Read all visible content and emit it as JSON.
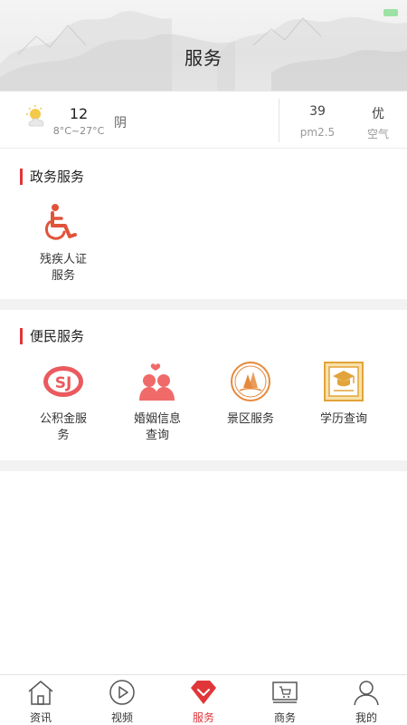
{
  "header": {
    "title": "服务"
  },
  "weather": {
    "temperature": "12",
    "range": "8°C~27°C",
    "condition": "阴",
    "pm_value": "39",
    "pm_label": "pm2.5",
    "aq_value": "优",
    "aq_label": "空气",
    "icon": "cloudy-sun-icon"
  },
  "gov_services": {
    "title": "政务服务",
    "items": [
      {
        "label_line1": "残疾人证",
        "label_line2": "服务",
        "icon": "wheelchair-icon"
      }
    ]
  },
  "public_services": {
    "title": "便民服务",
    "items": [
      {
        "label_line1": "公积金服",
        "label_line2": "务",
        "icon": "housing-fund-icon"
      },
      {
        "label_line1": "婚姻信息",
        "label_line2": "查询",
        "icon": "couple-icon"
      },
      {
        "label_line1": "景区服务",
        "label_line2": "",
        "icon": "scenic-area-icon"
      },
      {
        "label_line1": "学历查询",
        "label_line2": "",
        "icon": "graduation-cap-icon"
      }
    ]
  },
  "nav": {
    "active": "服务",
    "accent_color": "#e0363a",
    "items": [
      {
        "label": "资讯",
        "icon": "home-icon"
      },
      {
        "label": "视频",
        "icon": "play-icon"
      },
      {
        "label": "服务",
        "icon": "gem-icon"
      },
      {
        "label": "商务",
        "icon": "cart-icon"
      },
      {
        "label": "我的",
        "icon": "user-icon"
      }
    ]
  }
}
